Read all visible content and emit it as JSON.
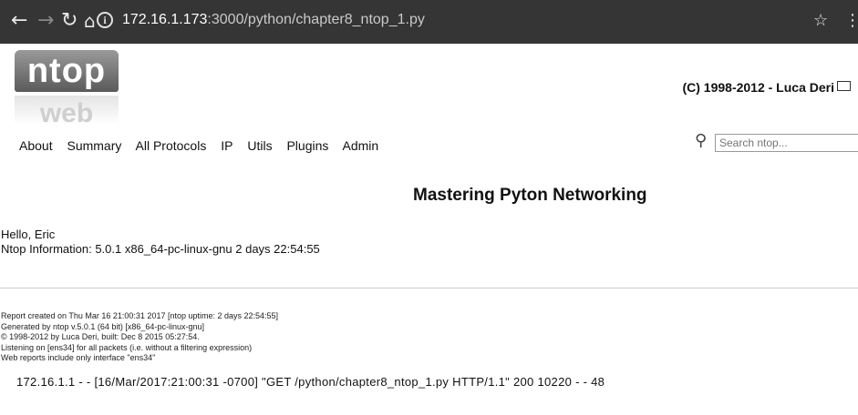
{
  "browser": {
    "url_host": "172.16.1.173",
    "url_rest": ":3000/python/chapter8_ntop_1.py"
  },
  "header": {
    "logo_text": "ntop",
    "logo_sub": "web",
    "copyright": "(C) 1998-2012 - Luca Deri"
  },
  "nav": {
    "items": [
      "About",
      "Summary",
      "All Protocols",
      "IP",
      "Utils",
      "Plugins",
      "Admin"
    ]
  },
  "search": {
    "placeholder": "Search ntop..."
  },
  "main": {
    "title": "Mastering Pyton Networking",
    "hello": "Hello, Eric",
    "info": "Ntop Information: 5.0.1 x86_64-pc-linux-gnu 2 days 22:54:55"
  },
  "report": {
    "lines": [
      "Report created on Thu Mar 16 21:00:31 2017 [ntop uptime: 2 days 22:54:55]",
      "Generated by ntop v.5.0.1 (64 bit) [x86_64-pc-linux-gnu]",
      "© 1998-2012 by Luca Deri, built: Dec 8 2015 05:27:54.",
      "Listening on [ens34] for all packets (i.e. without a filtering expression)",
      "Web reports include only interface \"ens34\""
    ]
  },
  "log_line": "172.16.1.1 - - [16/Mar/2017:21:00:31 -0700] \"GET /python/chapter8_ntop_1.py HTTP/1.1\" 200 10220 - - 48"
}
